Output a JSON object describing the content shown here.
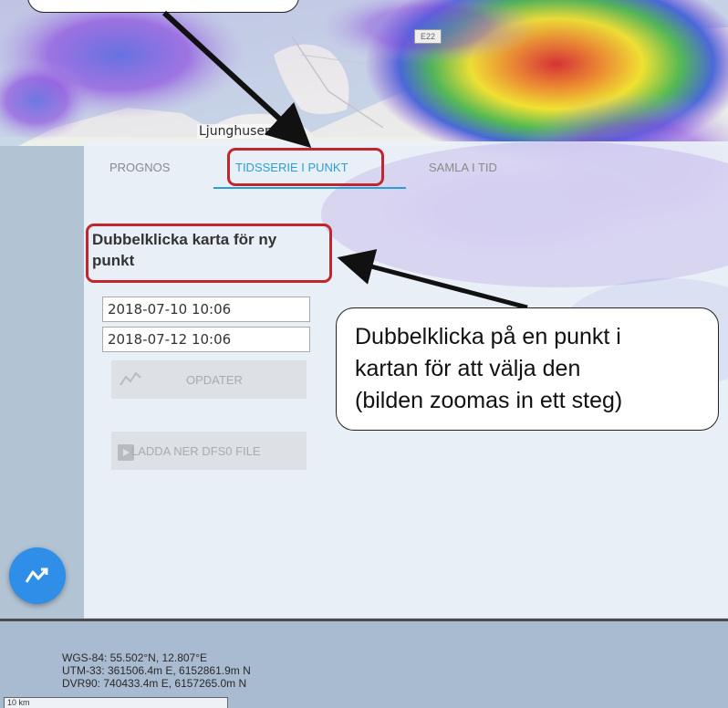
{
  "map": {
    "place_label": "Ljunghusen",
    "road_shield": "E22"
  },
  "tabs": [
    {
      "label": "PROGNOS",
      "active": false
    },
    {
      "label": "TIDSSERIE I PUNKT",
      "active": true
    },
    {
      "label": "SAMLA I TID",
      "active": false
    }
  ],
  "panel": {
    "instruction": "Dubbelklicka karta för ny punkt",
    "start_date": "2018-07-10 10:06",
    "end_date": "2018-07-12 10:06",
    "update_button": "OPDATER",
    "download_button": "LADDA NER DFS0 FILE"
  },
  "callout": {
    "lines": [
      "Dubbelklicka på en punkt i",
      "kartan för att välja den",
      "(bilden zoomas in ett steg)"
    ]
  },
  "footer": {
    "wgs84": "WGS-84: 55.502°N, 12.807°E",
    "utm33": "UTM-33: 361506.4m E, 6152861.9m N",
    "dvr90": "DVR90: 740433.4m E, 6157265.0m N",
    "scale": "10 km"
  },
  "colors": {
    "accent": "#2a9fd6",
    "highlight": "#c0262c",
    "fab": "#2f8ee8"
  }
}
